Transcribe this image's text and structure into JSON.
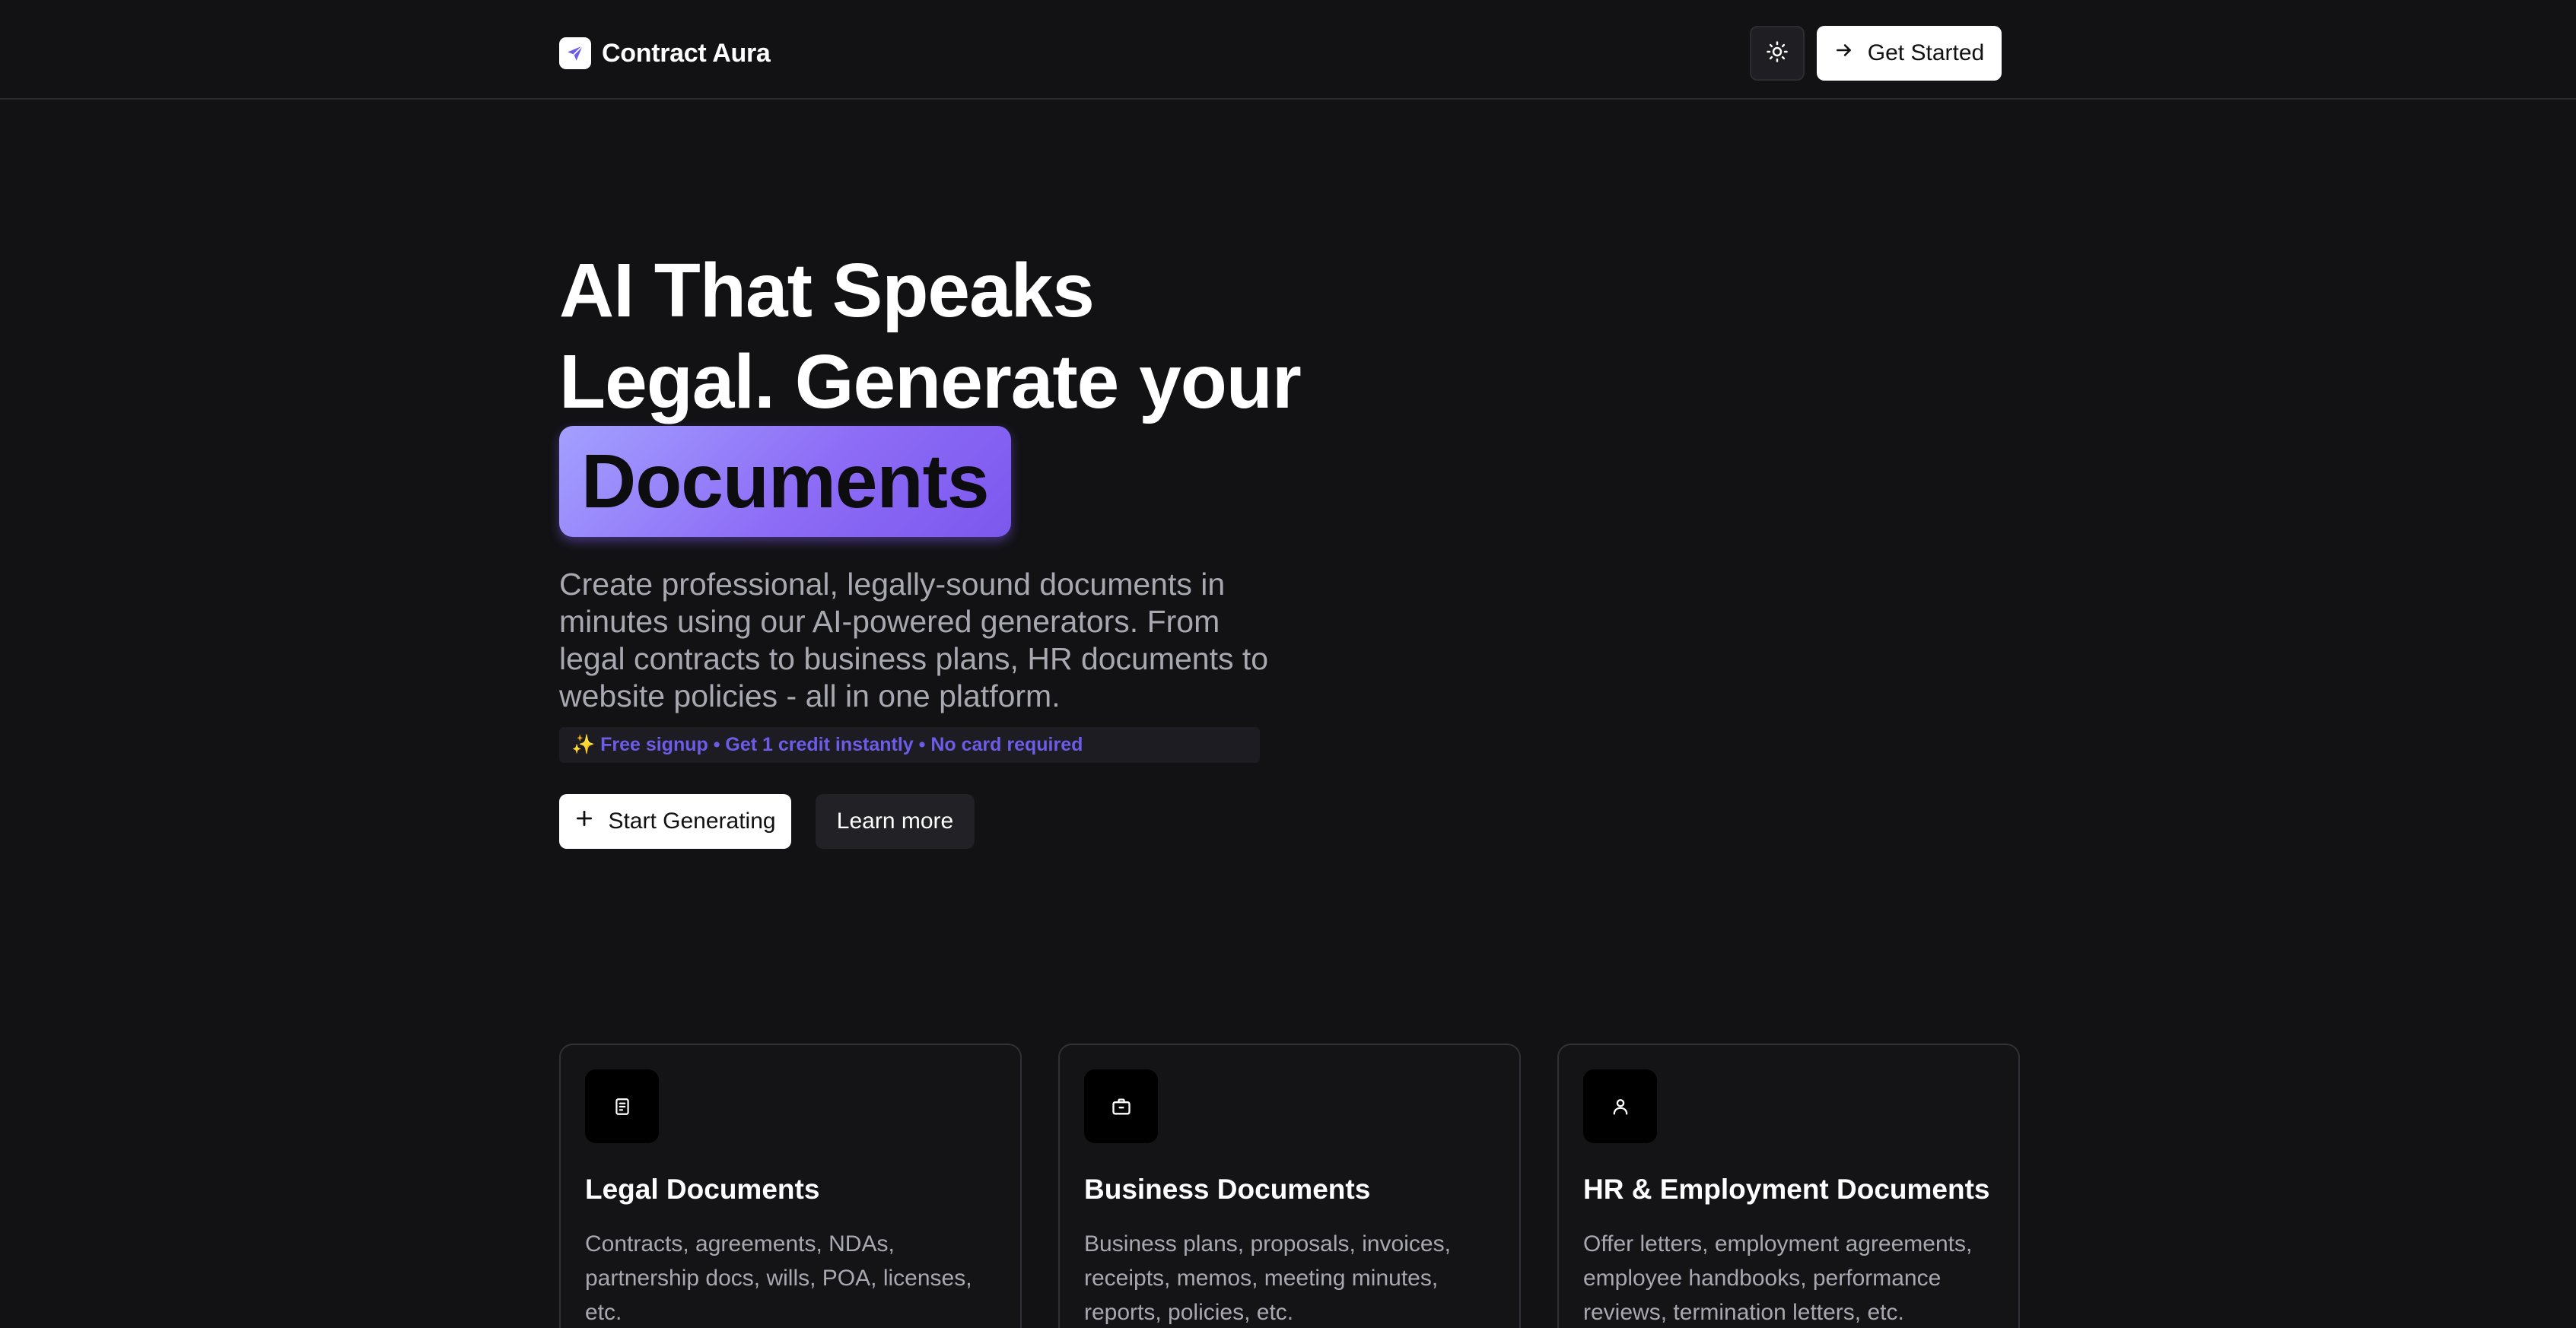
{
  "header": {
    "brand_name": "Contract Aura",
    "get_started_label": "Get Started"
  },
  "hero": {
    "title_line1": "AI That Speaks",
    "title_line2": "Legal. Generate your",
    "title_highlight": "Documents",
    "description": "Create professional, legally-sound documents in minutes using our AI-powered generators. From legal contracts to business plans, HR documents to website policies - all in one platform.",
    "promo": "✨ Free signup • Get 1 credit instantly • No card required",
    "primary_cta": "Start Generating",
    "secondary_cta": "Learn more"
  },
  "cards": [
    {
      "icon": "document-icon",
      "title": "Legal Documents",
      "description": "Contracts, agreements, NDAs, partnership docs, wills, POA, licenses, etc."
    },
    {
      "icon": "briefcase-icon",
      "title": "Business Documents",
      "description": "Business plans, proposals, invoices, receipts, memos, meeting minutes, reports, policies, etc."
    },
    {
      "icon": "user-icon",
      "title": "HR & Employment Documents",
      "description": "Offer letters, employment agreements, employee handbooks, performance reviews, termination letters, etc."
    }
  ],
  "colors": {
    "background": "#121214",
    "accent": "#8d6cf6",
    "promo_text": "#6d5ce8"
  }
}
